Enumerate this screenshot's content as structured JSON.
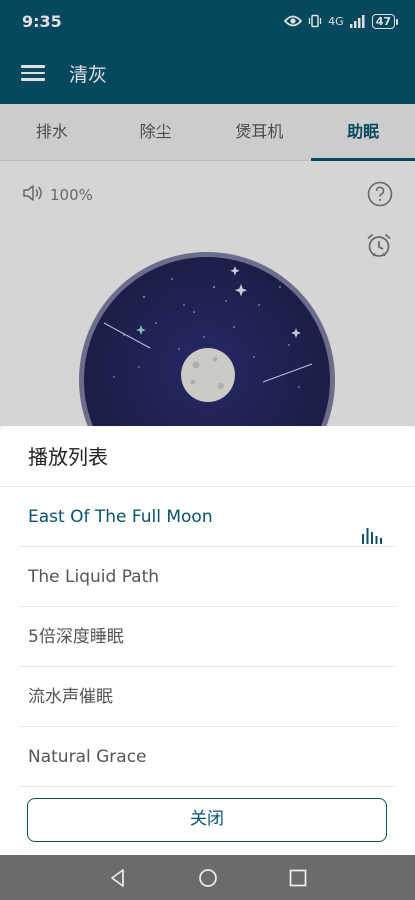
{
  "status_bar": {
    "time": "9:35",
    "network": "4G",
    "battery": "47"
  },
  "app_bar": {
    "title": "清灰",
    "menu_icon": "hamburger-menu-icon"
  },
  "tabs": [
    {
      "label": "排水",
      "active": false
    },
    {
      "label": "除尘",
      "active": false
    },
    {
      "label": "煲耳机",
      "active": false
    },
    {
      "label": "助眠",
      "active": true
    }
  ],
  "player": {
    "volume": "100%",
    "volume_icon": "speaker-icon",
    "help_icon": "question-icon",
    "alarm_icon": "alarm-clock-icon"
  },
  "playlist": {
    "title": "播放列表",
    "tracks": [
      {
        "name": "East Of The Full Moon",
        "playing": true
      },
      {
        "name": "The Liquid Path",
        "playing": false
      },
      {
        "name": "5倍深度睡眠",
        "playing": false
      },
      {
        "name": "流水声催眠",
        "playing": false
      },
      {
        "name": "Natural Grace",
        "playing": false
      }
    ],
    "close_label": "关闭"
  },
  "colors": {
    "primary": "#07536a",
    "disc_night": "#202253"
  }
}
